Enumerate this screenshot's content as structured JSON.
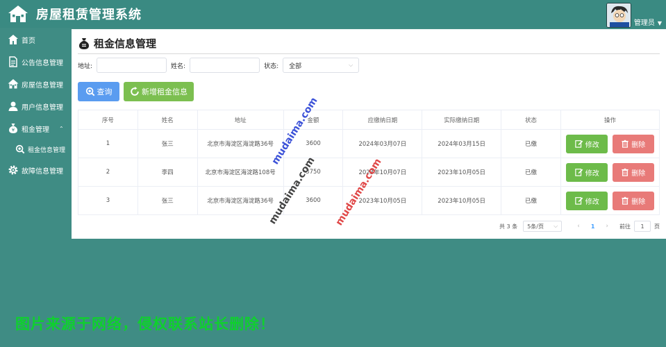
{
  "header": {
    "title": "房屋租赁管理系统",
    "user_name": "管理员"
  },
  "sidebar": {
    "items": [
      {
        "label": "首页",
        "icon": "home-icon"
      },
      {
        "label": "公告信息管理",
        "icon": "document-icon"
      },
      {
        "label": "房屋信息管理",
        "icon": "house-icon"
      },
      {
        "label": "用户信息管理",
        "icon": "user-icon"
      },
      {
        "label": "租金管理",
        "icon": "money-bag-icon"
      },
      {
        "label": "租金信息管理",
        "icon": "search-icon"
      },
      {
        "label": "故障信息管理",
        "icon": "gear-icon"
      }
    ]
  },
  "page": {
    "title": "租金信息管理"
  },
  "filters": {
    "address_label": "地址:",
    "name_label": "姓名:",
    "status_label": "状态:",
    "status_value": "全部"
  },
  "buttons": {
    "query": "查询",
    "add": "新增租金信息",
    "edit": "修改",
    "delete": "删除"
  },
  "table": {
    "headers": [
      "序号",
      "姓名",
      "地址",
      "金额",
      "应缴纳日期",
      "实际缴纳日期",
      "状态",
      "操作"
    ],
    "rows": [
      [
        "1",
        "张三",
        "北京市海淀区海淀路36号",
        "3600",
        "2024年03月07日",
        "2024年03月15日",
        "已缴"
      ],
      [
        "2",
        "李四",
        "北京市海淀区海淀路108号",
        "3750",
        "2023年10月07日",
        "2023年10月05日",
        "已缴"
      ],
      [
        "3",
        "张三",
        "北京市海淀区海淀路36号",
        "3600",
        "2023年10月05日",
        "2023年10月05日",
        "已缴"
      ]
    ]
  },
  "pagination": {
    "total": "共 3 条",
    "page_size": "5条/页",
    "current_page": "1",
    "goto_label": "前往",
    "goto_value": "1",
    "page_suffix": "页"
  },
  "watermarks": {
    "site": "mudaima.com",
    "notice": "图片来源于网络，侵权联系站长删除！"
  },
  "colors": {
    "brand": "#3a8a82",
    "query": "#5a9cf0",
    "add": "#7cbf50",
    "edit": "#6dbb4a",
    "delete": "#e87a78"
  }
}
